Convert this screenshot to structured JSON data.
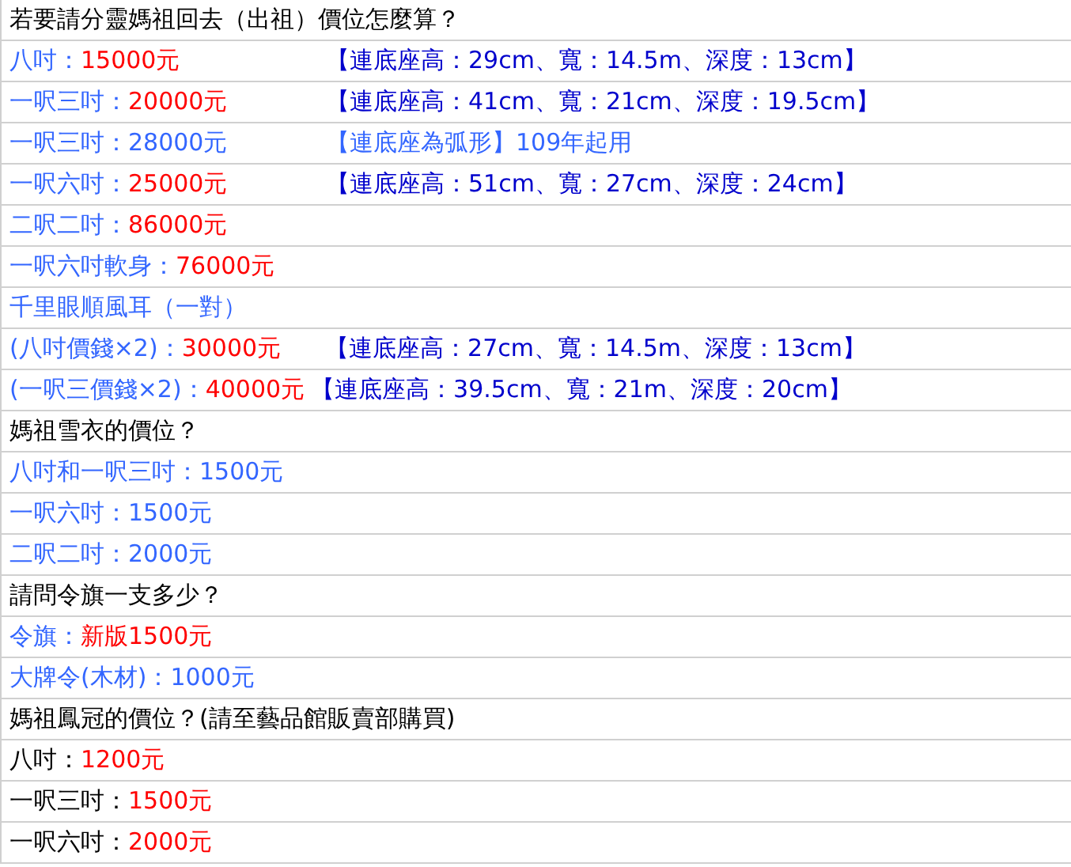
{
  "rows": [
    {
      "kind": "plain",
      "segments": [
        {
          "text": "若要請分靈媽祖回去（出祖）價位怎麼算？",
          "color": "#000000"
        }
      ]
    },
    {
      "kind": "columns",
      "segments": [
        {
          "text": "八吋：",
          "color": "#3366ff"
        },
        {
          "text": "15000元",
          "color": "#ff0000"
        }
      ],
      "note": [
        {
          "text": "【連底座高：29cm、寬：14.5m、深度：13cm】",
          "color": "#0000cc"
        }
      ]
    },
    {
      "kind": "columns",
      "segments": [
        {
          "text": "一呎三吋：",
          "color": "#3366ff"
        },
        {
          "text": "20000元",
          "color": "#ff0000"
        }
      ],
      "note": [
        {
          "text": "【連底座高：41cm、寬：21cm、深度：19.5cm】",
          "color": "#0000cc"
        }
      ]
    },
    {
      "kind": "columns",
      "segments": [
        {
          "text": "一呎三吋：28000元",
          "color": "#3366ff"
        }
      ],
      "note": [
        {
          "text": "【連底座為弧形】109年起用",
          "color": "#3366ff"
        }
      ]
    },
    {
      "kind": "columns",
      "segments": [
        {
          "text": "一呎六吋：",
          "color": "#3366ff"
        },
        {
          "text": "25000元",
          "color": "#ff0000"
        }
      ],
      "note": [
        {
          "text": "【連底座高：51cm、寬：27cm、深度：24cm】",
          "color": "#0000cc"
        }
      ]
    },
    {
      "kind": "plain",
      "segments": [
        {
          "text": "二呎二吋：",
          "color": "#3366ff"
        },
        {
          "text": "86000元",
          "color": "#ff0000"
        }
      ]
    },
    {
      "kind": "plain",
      "segments": [
        {
          "text": "一呎六吋軟身：",
          "color": "#3366ff"
        },
        {
          "text": "76000元",
          "color": "#ff0000"
        }
      ]
    },
    {
      "kind": "plain",
      "segments": [
        {
          "text": "千里眼順風耳（一對）",
          "color": "#3366ff"
        }
      ]
    },
    {
      "kind": "spaced",
      "segments": [
        {
          "text": "(八吋價錢×2)：",
          "color": "#3366ff"
        },
        {
          "text": "30000元",
          "color": "#ff0000"
        }
      ],
      "note": [
        {
          "text": "【連底座高：27cm、寬：14.5m、深度：13cm】",
          "color": "#0000cc"
        }
      ]
    },
    {
      "kind": "inline",
      "segments": [
        {
          "text": "(一呎三價錢×2)：",
          "color": "#3366ff"
        },
        {
          "text": "40000元",
          "color": "#ff0000"
        }
      ],
      "note": [
        {
          "text": "【連底座高：39.5cm、寬：21m、深度：20cm】",
          "color": "#0000cc"
        }
      ]
    },
    {
      "kind": "plain",
      "segments": [
        {
          "text": "媽祖雪衣的價位？",
          "color": "#000000"
        }
      ]
    },
    {
      "kind": "plain",
      "segments": [
        {
          "text": "八吋和一呎三吋：1500元",
          "color": "#3366ff"
        }
      ]
    },
    {
      "kind": "plain",
      "segments": [
        {
          "text": "一呎六吋：1500元",
          "color": "#3366ff"
        }
      ]
    },
    {
      "kind": "plain",
      "segments": [
        {
          "text": "二呎二吋：2000元",
          "color": "#3366ff"
        }
      ]
    },
    {
      "kind": "plain",
      "segments": [
        {
          "text": "請問令旗一支多少？",
          "color": "#000000"
        }
      ]
    },
    {
      "kind": "plain",
      "segments": [
        {
          "text": "令旗：",
          "color": "#3366ff"
        },
        {
          "text": "新版1500元",
          "color": "#ff0000"
        }
      ]
    },
    {
      "kind": "plain",
      "segments": [
        {
          "text": "大牌令(木材)：1000元",
          "color": "#3366ff"
        }
      ]
    },
    {
      "kind": "plain",
      "segments": [
        {
          "text": "媽祖鳳冠的價位？(請至藝品館販賣部購買)",
          "color": "#000000"
        }
      ]
    },
    {
      "kind": "plain",
      "segments": [
        {
          "text": "八吋：",
          "color": "#000000"
        },
        {
          "text": "1200元",
          "color": "#ff0000"
        }
      ]
    },
    {
      "kind": "plain",
      "segments": [
        {
          "text": "一呎三吋：",
          "color": "#000000"
        },
        {
          "text": "1500元",
          "color": "#ff0000"
        }
      ]
    },
    {
      "kind": "plain",
      "segments": [
        {
          "text": "一呎六吋：",
          "color": "#000000"
        },
        {
          "text": "2000元",
          "color": "#ff0000"
        }
      ]
    }
  ]
}
